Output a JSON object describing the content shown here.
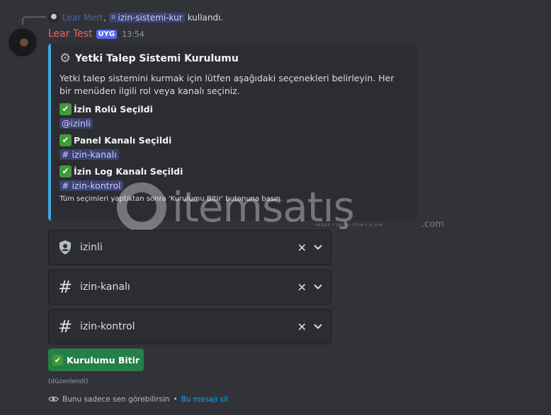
{
  "reply": {
    "author": "Lear Mert",
    "comma": ",",
    "command": "izin-sistemi-kur",
    "command_icon": "slash-command-icon",
    "action": "kullandı."
  },
  "message": {
    "author": "Lear Test",
    "badge": "UYG",
    "time": "13:54"
  },
  "embed": {
    "accent_color": "#3ba7e0",
    "title": "Yetki Talep Sistemi Kurulumu",
    "description": "Yetki talep sistemini kurmak için lütfen aşağıdaki seçenekleri belirleyin. Her bir menüden ilgili rol veya kanalı seçiniz.",
    "fields": [
      {
        "name": "İzin Rolü Seçildi",
        "value": "@izinli"
      },
      {
        "name": "Panel Kanalı Seçildi",
        "value": "# izin-kanalı"
      },
      {
        "name": "İzin Log Kanalı Seçildi",
        "value": "# izin-kontrol"
      }
    ],
    "footer": "Tüm seçimleri yaptıktan sonra 'Kurulumu Bitir' butonuna basın."
  },
  "selects": [
    {
      "icon": "role-shield-icon",
      "value": "izinli"
    },
    {
      "icon": "hash-icon",
      "value": "izin-kanalı"
    },
    {
      "icon": "hash-icon",
      "value": "izin-kontrol"
    }
  ],
  "button": {
    "label": "Kurulumu Bitir",
    "color": "#248046"
  },
  "edited": "(düzenlendi)",
  "ephemeral": {
    "text": "Bunu sadece sen görebilirsin",
    "separator": "•",
    "link": "Bu mesajı sil"
  },
  "watermark": {
    "brand": "itemsatış",
    "tagline": "HESAP / SKIN / İTEM / E-PİN",
    "suffix": ".com"
  }
}
